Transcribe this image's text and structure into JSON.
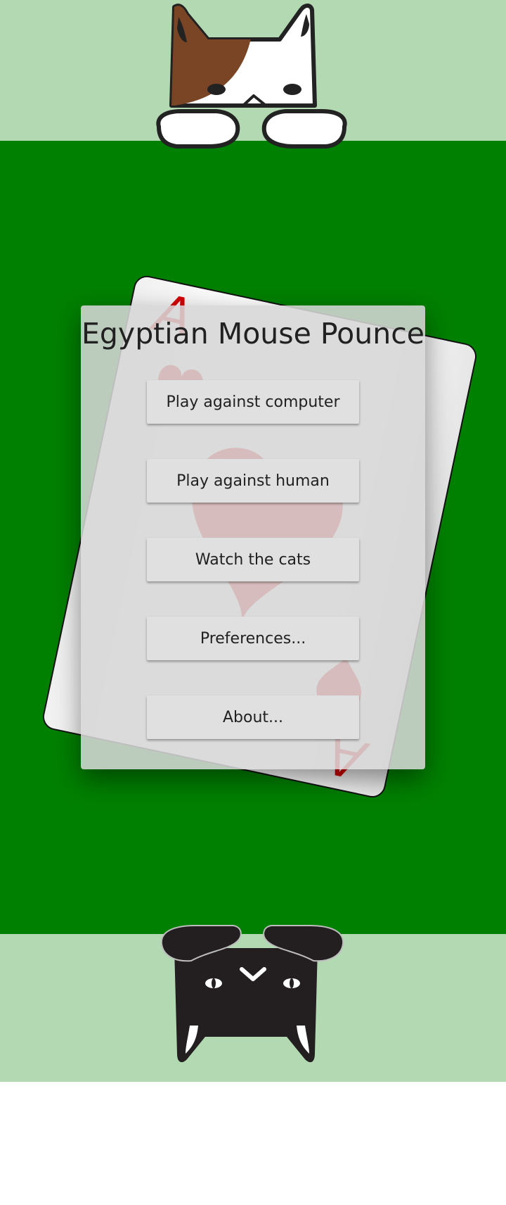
{
  "app": {
    "title": "Egyptian Mouse Pounce"
  },
  "card": {
    "rank": "A",
    "suit": "hearts",
    "suit_icon": "heart-icon",
    "suit_color": "#d40000"
  },
  "menu": {
    "play_computer": "Play against computer",
    "play_human": "Play against human",
    "watch_cats": "Watch the cats",
    "preferences": "Preferences...",
    "about": "About..."
  },
  "colors": {
    "table_green": "#008000",
    "player_area": "#b3d9b3",
    "dialog_bg": "#d6d6d6",
    "button_bg": "#e0e0e0",
    "text": "#212121"
  },
  "players": {
    "top_cat": "calico-cat-icon",
    "bottom_cat": "black-cat-icon"
  }
}
